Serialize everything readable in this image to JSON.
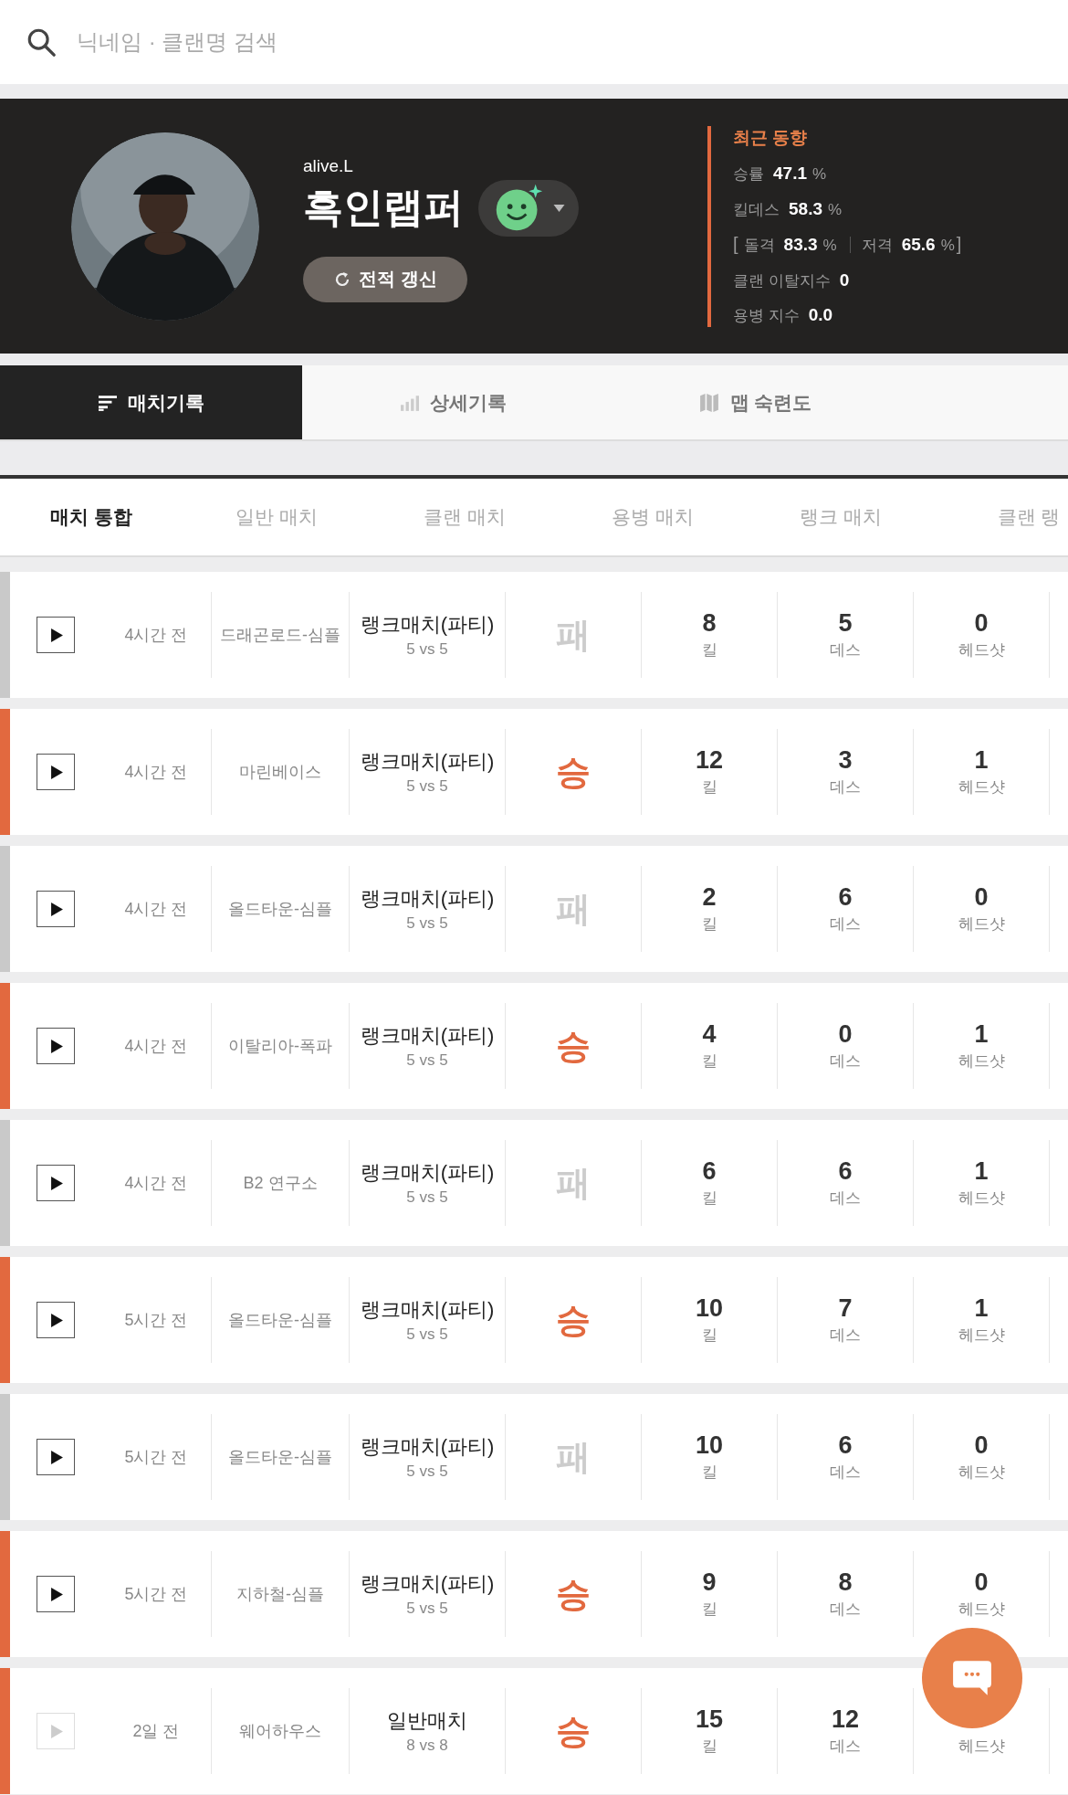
{
  "search": {
    "placeholder": "닉네임 · 클랜명 검색"
  },
  "profile": {
    "id": "alive.L",
    "nickname": "흑인랩퍼",
    "refresh_button": "전적 갱신",
    "recent": {
      "title": "최근 동향",
      "win_rate": {
        "label": "승률",
        "value": "47.1",
        "unit": "%"
      },
      "kd": {
        "label": "킬데스",
        "value": "58.3",
        "unit": "%"
      },
      "open_bracket": "[",
      "assault": {
        "label": "돌격",
        "value": "83.3",
        "unit": "%"
      },
      "sniper": {
        "label": "저격",
        "value": "65.6",
        "unit": "%"
      },
      "close_bracket": "]",
      "clan_leave": {
        "label": "클랜 이탈지수",
        "value": "0"
      },
      "mercenary": {
        "label": "용병 지수",
        "value": "0.0"
      }
    }
  },
  "tabs": [
    {
      "label": "매치기록",
      "selected": true,
      "kind": "list"
    },
    {
      "label": "상세기록",
      "selected": false,
      "kind": "chart"
    },
    {
      "label": "맵 숙련도",
      "selected": false,
      "kind": "map"
    }
  ],
  "subtabs": [
    {
      "label": "매치 통합",
      "selected": true
    },
    {
      "label": "일반 매치",
      "selected": false
    },
    {
      "label": "클랜 매치",
      "selected": false
    },
    {
      "label": "용병 매치",
      "selected": false
    },
    {
      "label": "랭크 매치",
      "selected": false
    },
    {
      "label": "클랜 랭",
      "selected": false
    }
  ],
  "matches": [
    {
      "time": "4시간 전",
      "map": "드래곤로드-심플",
      "mode": "랭크매치(파티)",
      "teams": "5 vs 5",
      "result": "패",
      "win": false,
      "disabled": false,
      "kills": "8",
      "kills_label": "킬",
      "deaths": "5",
      "deaths_label": "데스",
      "headshots": "0",
      "headshots_label": "헤드샷"
    },
    {
      "time": "4시간 전",
      "map": "마린베이스",
      "mode": "랭크매치(파티)",
      "teams": "5 vs 5",
      "result": "승",
      "win": true,
      "disabled": false,
      "kills": "12",
      "kills_label": "킬",
      "deaths": "3",
      "deaths_label": "데스",
      "headshots": "1",
      "headshots_label": "헤드샷"
    },
    {
      "time": "4시간 전",
      "map": "올드타운-심플",
      "mode": "랭크매치(파티)",
      "teams": "5 vs 5",
      "result": "패",
      "win": false,
      "disabled": false,
      "kills": "2",
      "kills_label": "킬",
      "deaths": "6",
      "deaths_label": "데스",
      "headshots": "0",
      "headshots_label": "헤드샷"
    },
    {
      "time": "4시간 전",
      "map": "이탈리아-폭파",
      "mode": "랭크매치(파티)",
      "teams": "5 vs 5",
      "result": "승",
      "win": true,
      "disabled": false,
      "kills": "4",
      "kills_label": "킬",
      "deaths": "0",
      "deaths_label": "데스",
      "headshots": "1",
      "headshots_label": "헤드샷"
    },
    {
      "time": "4시간 전",
      "map": "B2 연구소",
      "mode": "랭크매치(파티)",
      "teams": "5 vs 5",
      "result": "패",
      "win": false,
      "disabled": false,
      "kills": "6",
      "kills_label": "킬",
      "deaths": "6",
      "deaths_label": "데스",
      "headshots": "1",
      "headshots_label": "헤드샷"
    },
    {
      "time": "5시간 전",
      "map": "올드타운-심플",
      "mode": "랭크매치(파티)",
      "teams": "5 vs 5",
      "result": "승",
      "win": true,
      "disabled": false,
      "kills": "10",
      "kills_label": "킬",
      "deaths": "7",
      "deaths_label": "데스",
      "headshots": "1",
      "headshots_label": "헤드샷"
    },
    {
      "time": "5시간 전",
      "map": "올드타운-심플",
      "mode": "랭크매치(파티)",
      "teams": "5 vs 5",
      "result": "패",
      "win": false,
      "disabled": false,
      "kills": "10",
      "kills_label": "킬",
      "deaths": "6",
      "deaths_label": "데스",
      "headshots": "0",
      "headshots_label": "헤드샷"
    },
    {
      "time": "5시간 전",
      "map": "지하철-심플",
      "mode": "랭크매치(파티)",
      "teams": "5 vs 5",
      "result": "승",
      "win": true,
      "disabled": false,
      "kills": "9",
      "kills_label": "킬",
      "deaths": "8",
      "deaths_label": "데스",
      "headshots": "0",
      "headshots_label": "헤드샷"
    },
    {
      "time": "2일 전",
      "map": "웨어하우스",
      "mode": "일반매치",
      "teams": "8 vs 8",
      "result": "승",
      "win": true,
      "disabled": true,
      "kills": "15",
      "kills_label": "킬",
      "deaths": "12",
      "deaths_label": "데스",
      "headshots_label": "헤드샷"
    }
  ]
}
